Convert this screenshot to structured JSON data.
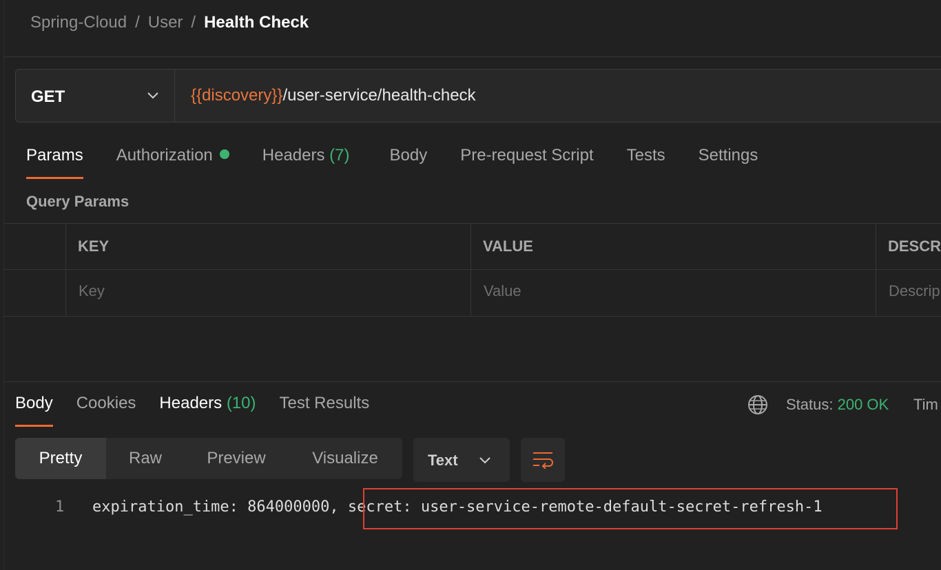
{
  "breadcrumb": {
    "items": [
      "Spring-Cloud",
      "User"
    ],
    "separator": "/",
    "current": "Health Check"
  },
  "request": {
    "method": "GET",
    "url_variable": "{{discovery}}",
    "url_path": "/user-service/health-check"
  },
  "request_tabs": [
    {
      "label": "Params",
      "active": true
    },
    {
      "label": "Authorization",
      "indicator": "green-dot"
    },
    {
      "label": "Headers",
      "count": "(7)"
    },
    {
      "label": "Body"
    },
    {
      "label": "Pre-request Script"
    },
    {
      "label": "Tests"
    },
    {
      "label": "Settings"
    }
  ],
  "query_params": {
    "title": "Query Params",
    "columns": [
      "KEY",
      "VALUE",
      "DESCR"
    ],
    "placeholders": [
      "Key",
      "Value",
      "Descrip"
    ]
  },
  "response_tabs": [
    {
      "label": "Body",
      "active": true
    },
    {
      "label": "Cookies"
    },
    {
      "label": "Headers",
      "count": "(10)"
    },
    {
      "label": "Test Results"
    }
  ],
  "status": {
    "label": "Status:",
    "value": "200 OK",
    "time_label": "Tim"
  },
  "view_modes": [
    "Pretty",
    "Raw",
    "Preview",
    "Visualize"
  ],
  "active_view_mode": "Pretty",
  "format": "Text",
  "code_lines": [
    {
      "number": "1",
      "text_before": "expiration_time: 864000000,",
      "text_highlighted": "secret: user-service-remote-default-secret-refresh-1"
    }
  ],
  "colors": {
    "accent": "#ef6a33",
    "variable": "#e8753c",
    "success": "#3cb371",
    "highlight_box": "#e0412f"
  },
  "icons": {
    "method_dropdown": "chevron-down-icon",
    "globe": "globe-icon",
    "format_dropdown": "chevron-down-icon",
    "wrap": "wrap-lines-icon"
  }
}
